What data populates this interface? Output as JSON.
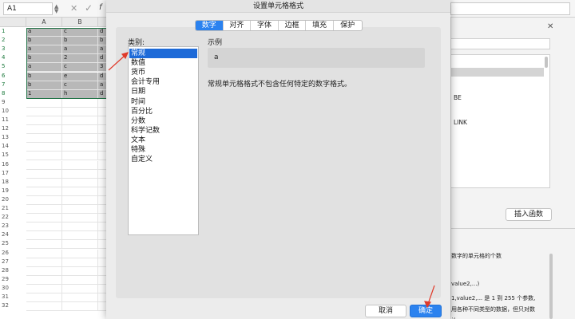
{
  "formula_bar": {
    "cell_ref": "A1",
    "cancel_glyph": "✕",
    "enter_glyph": "✓",
    "fx_label": "f"
  },
  "sheet": {
    "columns": [
      "A",
      "B"
    ],
    "row_numbers": [
      "1",
      "2",
      "3",
      "4",
      "5",
      "6",
      "7",
      "8",
      "9",
      "10",
      "11",
      "12",
      "13",
      "14",
      "15",
      "16",
      "17",
      "18",
      "19",
      "20",
      "21",
      "22",
      "23",
      "24",
      "25",
      "26",
      "27",
      "28",
      "29",
      "30",
      "31",
      "32"
    ],
    "rows": [
      [
        "a",
        "c",
        "d"
      ],
      [
        "b",
        "b",
        "b"
      ],
      [
        "a",
        "a",
        "a"
      ],
      [
        "b",
        "2",
        "d"
      ],
      [
        "a",
        "c",
        "3"
      ],
      [
        "b",
        "e",
        "d"
      ],
      [
        "b",
        "c",
        "a"
      ],
      [
        "1",
        "h",
        "d"
      ]
    ]
  },
  "dialog": {
    "title": "设置单元格格式",
    "tabs": [
      {
        "label": "数字",
        "active": true
      },
      {
        "label": "对齐",
        "active": false
      },
      {
        "label": "字体",
        "active": false
      },
      {
        "label": "边框",
        "active": false
      },
      {
        "label": "填充",
        "active": false
      },
      {
        "label": "保护",
        "active": false
      }
    ],
    "category_label": "类别:",
    "categories": [
      "常规",
      "数值",
      "货币",
      "会计专用",
      "日期",
      "时间",
      "百分比",
      "分数",
      "科学记数",
      "文本",
      "特殊",
      "自定义"
    ],
    "selected_category": "常规",
    "sample_label": "示例",
    "sample_value": "a",
    "description": "常规单元格格式不包含任何特定的数字格式。",
    "cancel_label": "取消",
    "ok_label": "确定"
  },
  "right_pane": {
    "list_items": [
      "BE",
      "LINK"
    ],
    "insert_function_label": "插入函数",
    "description_lines": [
      "数字的单元格的个数",
      "value2,...)",
      "1,value2,... 是 1 到 255 个参数,",
      "用各种不同类型的数据，但只对数",
      "计"
    ]
  },
  "colors": {
    "accent": "#2b82ef",
    "selected_item": "#1d6ad8",
    "selection_border": "#217346",
    "annotation_arrow": "#e03a2a"
  }
}
